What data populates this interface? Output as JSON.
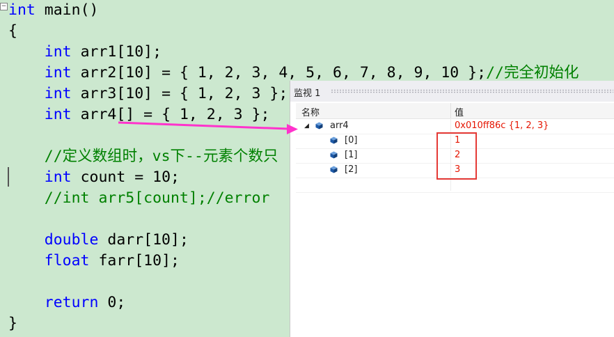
{
  "code": {
    "lines": [
      {
        "parts": [
          {
            "t": "int",
            "c": "kw"
          },
          {
            "t": " main()",
            "c": ""
          }
        ]
      },
      {
        "parts": [
          {
            "t": "{",
            "c": ""
          }
        ]
      },
      {
        "parts": [
          {
            "t": "    ",
            "c": ""
          },
          {
            "t": "int",
            "c": "kw"
          },
          {
            "t": " arr1[10];",
            "c": ""
          }
        ]
      },
      {
        "parts": [
          {
            "t": "    ",
            "c": ""
          },
          {
            "t": "int",
            "c": "kw"
          },
          {
            "t": " arr2[10] = { 1, 2, 3, 4, 5, 6, 7, 8, 9, 10 };",
            "c": ""
          },
          {
            "t": "//完全初始化",
            "c": "cm"
          }
        ]
      },
      {
        "parts": [
          {
            "t": "    ",
            "c": ""
          },
          {
            "t": "int",
            "c": "kw"
          },
          {
            "t": " arr3[10] = { 1, 2, 3 };",
            "c": ""
          }
        ]
      },
      {
        "parts": [
          {
            "t": "    ",
            "c": ""
          },
          {
            "t": "int",
            "c": "kw"
          },
          {
            "t": " arr4[] = { 1, 2, 3 };",
            "c": ""
          }
        ]
      },
      {
        "parts": [
          {
            "t": "",
            "c": ""
          }
        ]
      },
      {
        "parts": [
          {
            "t": "    ",
            "c": ""
          },
          {
            "t": "//定义数组时，vs下--元素个数只",
            "c": "cm"
          }
        ]
      },
      {
        "parts": [
          {
            "t": "    ",
            "c": ""
          },
          {
            "t": "int",
            "c": "kw"
          },
          {
            "t": " count = 10;",
            "c": ""
          }
        ]
      },
      {
        "parts": [
          {
            "t": "    ",
            "c": ""
          },
          {
            "t": "//int arr5[count];//error",
            "c": "cm"
          }
        ]
      },
      {
        "parts": [
          {
            "t": "",
            "c": ""
          }
        ]
      },
      {
        "parts": [
          {
            "t": "    ",
            "c": ""
          },
          {
            "t": "double",
            "c": "kw"
          },
          {
            "t": " darr[10];",
            "c": ""
          }
        ]
      },
      {
        "parts": [
          {
            "t": "    ",
            "c": ""
          },
          {
            "t": "float",
            "c": "kw"
          },
          {
            "t": " farr[10];",
            "c": ""
          }
        ]
      },
      {
        "parts": [
          {
            "t": "",
            "c": ""
          }
        ]
      },
      {
        "parts": [
          {
            "t": "    ",
            "c": ""
          },
          {
            "t": "return",
            "c": "kw"
          },
          {
            "t": " 0;",
            "c": ""
          }
        ]
      },
      {
        "parts": [
          {
            "t": "}",
            "c": ""
          }
        ]
      }
    ],
    "fold_glyph": "−"
  },
  "watch": {
    "title": "监视 1",
    "columns": {
      "name": "名称",
      "value": "值"
    },
    "expander_glyph": "◢",
    "rows": [
      {
        "name": "arr4",
        "value": "0x010ff86c {1, 2, 3}",
        "level": 0
      },
      {
        "name": "[0]",
        "value": "1",
        "level": 1
      },
      {
        "name": "[1]",
        "value": "2",
        "level": 1
      },
      {
        "name": "[2]",
        "value": "3",
        "level": 1
      }
    ]
  },
  "colors": {
    "editor_bg": "#cce8cf",
    "keyword": "#0000ff",
    "comment": "#008000",
    "watch_value": "#e51400",
    "arrow": "#ff33cc",
    "highlight_box": "#e53935"
  }
}
